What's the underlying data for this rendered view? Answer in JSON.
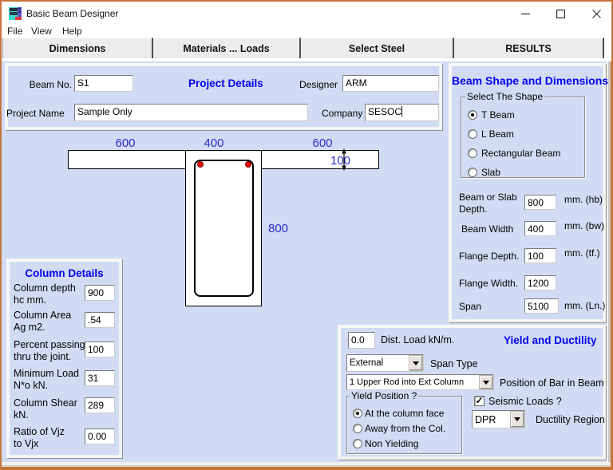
{
  "window": {
    "title": "Basic Beam Designer"
  },
  "menu": {
    "items": [
      {
        "label": "File"
      },
      {
        "label": "View"
      },
      {
        "label": "Help"
      }
    ]
  },
  "tabs": [
    {
      "label": "Dimensions"
    },
    {
      "label": "Materials ... Loads"
    },
    {
      "label": "Select Steel"
    },
    {
      "label": "RESULTS"
    }
  ],
  "project": {
    "title": "Project Details",
    "beam_no": {
      "label": "Beam No.",
      "value": "S1"
    },
    "designer": {
      "label": "Designer",
      "value": "ARM"
    },
    "project_name": {
      "label": "Project Name",
      "value": "Sample Only"
    },
    "company": {
      "label": "Company",
      "value": "SESOC"
    }
  },
  "drawing": {
    "flange_left_width": "600",
    "web_width": "400",
    "flange_right_width": "600",
    "flange_depth": "100",
    "beam_depth": "800"
  },
  "column_details": {
    "title": "Column Details",
    "rows": [
      {
        "label1": "Column depth",
        "label2": "hc mm.",
        "value": "900"
      },
      {
        "label1": "Column Area",
        "label2": "Ag m2.",
        "value": ".54"
      },
      {
        "label1": "Percent passing",
        "label2": "thru the joint.",
        "value": "100"
      },
      {
        "label1": "Minimum Load",
        "label2": "N*o kN.",
        "value": "31"
      },
      {
        "label1": "Column Shear",
        "label2": "kN.",
        "value": "289"
      },
      {
        "label1": "Ratio of Vjz",
        "label2": "to Vjx",
        "value": "0.00"
      }
    ]
  },
  "beam_shape": {
    "title": "Beam Shape and Dimensions",
    "shape_group": {
      "label": "Select The Shape",
      "options": [
        {
          "label": "T Beam",
          "selected": true
        },
        {
          "label": "L Beam",
          "selected": false
        },
        {
          "label": "Rectangular Beam",
          "selected": false
        },
        {
          "label": "Slab",
          "selected": false
        }
      ]
    },
    "fields": [
      {
        "label1": "Beam or Slab",
        "label2": "Depth.",
        "value": "800",
        "unit": "mm. (hb)"
      },
      {
        "label1": "Beam Width",
        "label2": "",
        "value": "400",
        "unit": "mm. (bw)"
      },
      {
        "label1": "Flange Depth.",
        "label2": "",
        "value": "100",
        "unit": "mm. (tf.)"
      },
      {
        "label1": "Flange Width.",
        "label2": "",
        "value": "1200",
        "unit": ""
      },
      {
        "label1": "Span",
        "label2": "",
        "value": "5100",
        "unit": "mm. (Ln.)"
      }
    ]
  },
  "yield_ductility": {
    "title": "Yield and Ductility",
    "dist_load": {
      "value": "0.0",
      "label": "Dist. Load kN/m."
    },
    "span_type": {
      "value": "External",
      "label": "Span Type"
    },
    "bar_position": {
      "value": "1 Upper Rod into Ext Column",
      "label": "Position of Bar in Beam"
    },
    "yield_group": {
      "label": "Yield Position ?",
      "options": [
        {
          "label": "At the column face",
          "selected": true
        },
        {
          "label": "Away from the Col.",
          "selected": false
        },
        {
          "label": "Non Yielding",
          "selected": false
        }
      ]
    },
    "seismic": {
      "label": "Seismic Loads ?",
      "checked": true,
      "checkmark": "✓"
    },
    "ductility": {
      "value": "DPR",
      "label": "Ductility Region"
    }
  }
}
